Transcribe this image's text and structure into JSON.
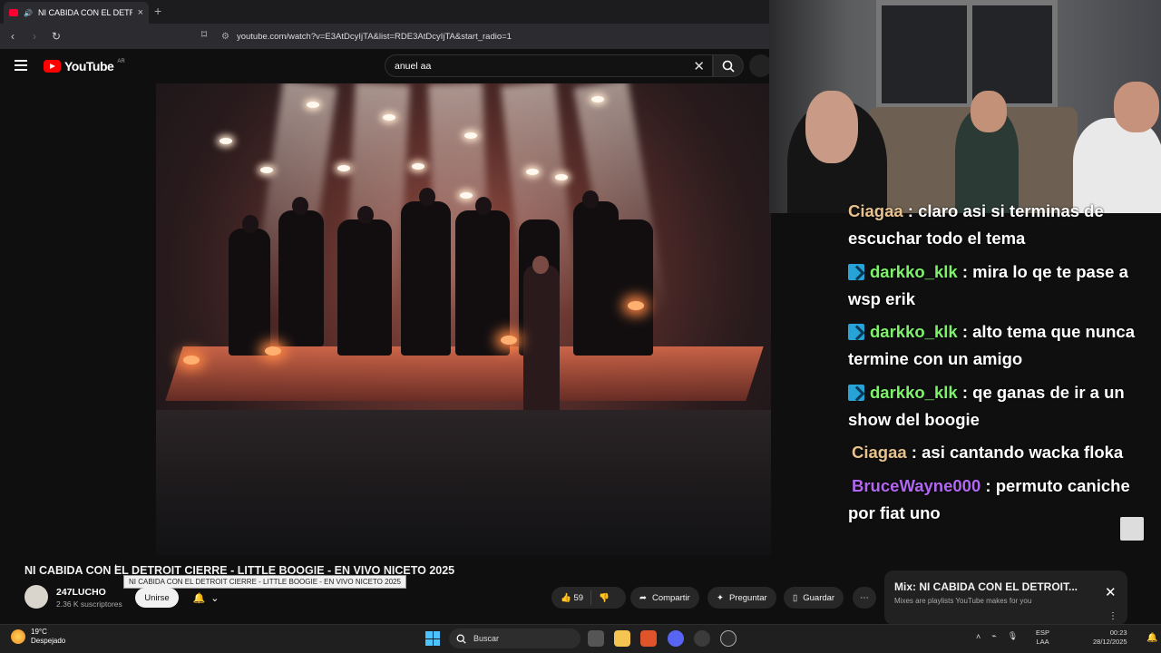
{
  "browser": {
    "tab_title": "NI CABIDA CON EL DETROIT",
    "url": "youtube.com/watch?v=E3AtDcyIjTA&list=RDE3AtDcyIjTA&start_radio=1"
  },
  "youtube": {
    "logo_text": "YouTube",
    "country": "AR",
    "search_value": "anuel aa"
  },
  "chat": {
    "messages": [
      {
        "user": "Ciagaa",
        "text": "claro asi si terminas de escuchar todo el tema",
        "color": "#e8c28d",
        "badge": false
      },
      {
        "user": "darkko_klk",
        "text": "mira lo qe te pase a wsp erik",
        "color": "#7ff26b",
        "badge": true
      },
      {
        "user": "darkko_klk",
        "text": "alto tema que nunca termine con un amigo",
        "color": "#7ff26b",
        "badge": true
      },
      {
        "user": "darkko_klk",
        "text": "qe ganas de ir a un show del boogie",
        "color": "#7ff26b",
        "badge": true
      },
      {
        "user": "Ciagaa",
        "text": "asi cantando wacka floka",
        "color": "#e8c28d",
        "badge": false
      },
      {
        "user": "BruceWayne000",
        "text": "permuto caniche por fiat uno",
        "color": "#b267f2",
        "badge": false
      }
    ]
  },
  "video": {
    "title": "NI CABIDA CON EL DETROIT CIERRE - LITTLE BOOGIE - EN VIVO NICETO 2025",
    "tooltip": "NI CABIDA CON EL DETROIT CIERRE - LITTLE BOOGIE - EN VIVO NICETO 2025",
    "channel": "247LUCHO",
    "subscribers": "2.36 K suscriptores",
    "join_label": "Unirse",
    "likes": "59",
    "share_label": "Compartir",
    "ask_label": "Preguntar",
    "save_label": "Guardar"
  },
  "mix": {
    "title": "Mix: NI CABIDA CON EL DETROIT...",
    "subtitle": "Mixes are playlists YouTube makes for you"
  },
  "taskbar": {
    "temp": "19°C",
    "weather": "Despejado",
    "search_label": "Buscar",
    "lang_top": "ESP",
    "lang_bottom": "LAA",
    "time": "00:23",
    "date": "28/12/2025"
  },
  "colors": {
    "youtube_red": "#ff0000",
    "badge_blue": "#27a3d8"
  }
}
